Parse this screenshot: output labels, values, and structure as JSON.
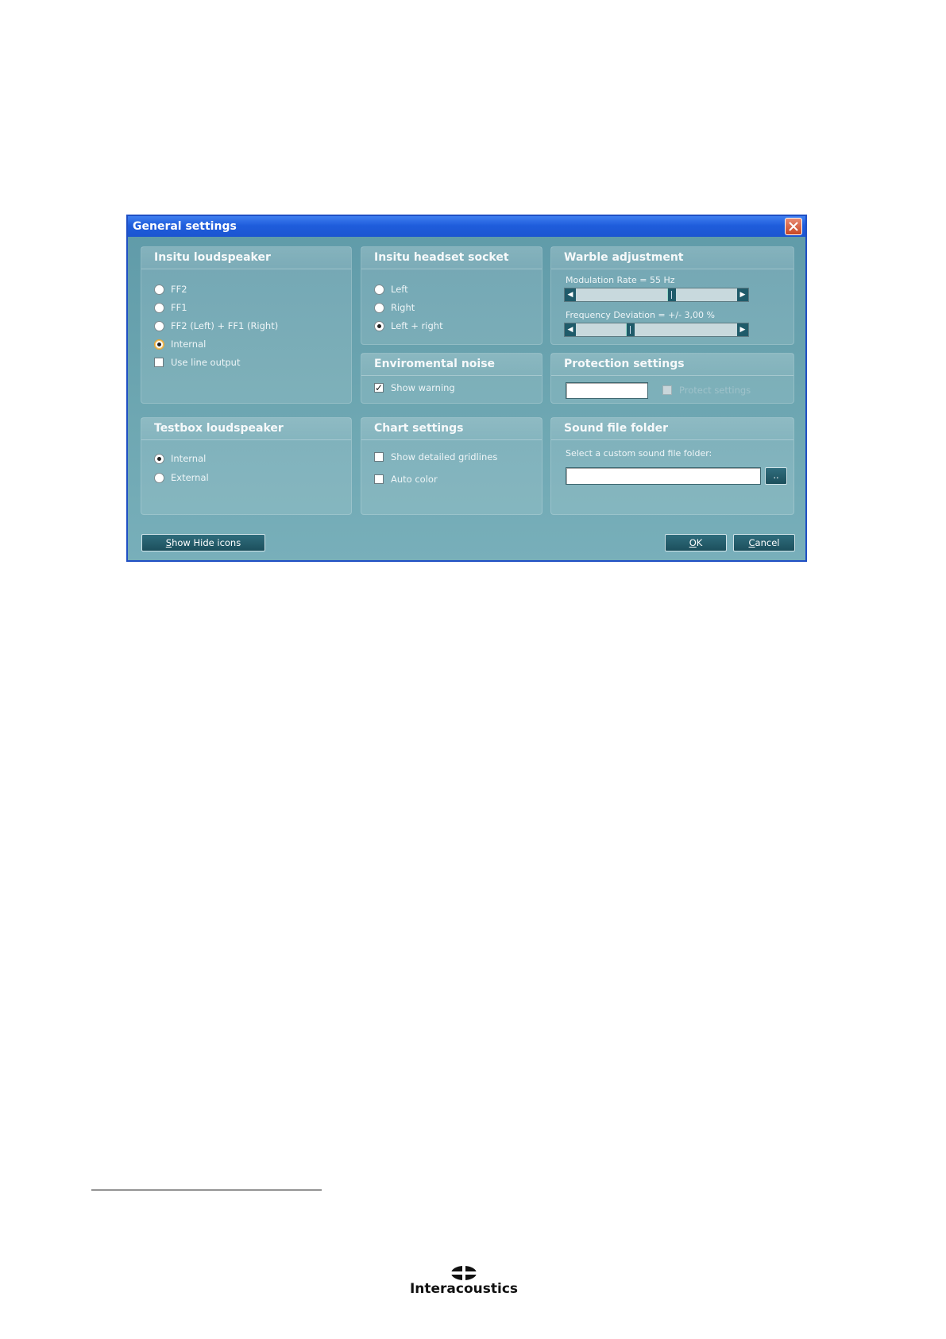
{
  "dialog": {
    "title": "General settings"
  },
  "insitu_loudspeaker": {
    "title": "Insitu loudspeaker",
    "options": [
      "FF2",
      "FF1",
      "FF2 (Left) + FF1 (Right)",
      "Internal"
    ],
    "selected": "Internal",
    "line_output_label": "Use line output",
    "line_output_checked": false
  },
  "insitu_headset": {
    "title": "Insitu headset socket",
    "options": [
      "Left",
      "Right",
      "Left + right"
    ],
    "selected": "Left + right"
  },
  "warble": {
    "title": "Warble adjustment",
    "modulation_label": "Modulation Rate = 55 Hz",
    "modulation_fraction": 0.6,
    "deviation_label": "Frequency Deviation = +/- 3,00 %",
    "deviation_fraction": 0.33
  },
  "env_noise": {
    "title": "Enviromental noise",
    "show_warning_label": "Show warning",
    "show_warning_checked": true
  },
  "protection": {
    "title": "Protection settings",
    "password_value": "",
    "protect_label": "Protect settings",
    "protect_checked": false,
    "protect_disabled": true
  },
  "testbox_loudspeaker": {
    "title": "Testbox loudspeaker",
    "options": [
      "Internal",
      "External"
    ],
    "selected": "Internal"
  },
  "chart_settings": {
    "title": "Chart settings",
    "gridlines_label": "Show detailed gridlines",
    "auto_color_label": "Auto color"
  },
  "sound_folder": {
    "title": "Sound file folder",
    "select_label": "Select a custom sound file folder:",
    "path_value": "",
    "browse_label": ".."
  },
  "buttons": {
    "show_hide_first": "S",
    "show_hide_rest": "how Hide icons",
    "ok_first": "O",
    "ok_rest": "K",
    "cancel_first": "C",
    "cancel_rest": "ancel"
  },
  "logo": {
    "text": "Interacoustics"
  }
}
